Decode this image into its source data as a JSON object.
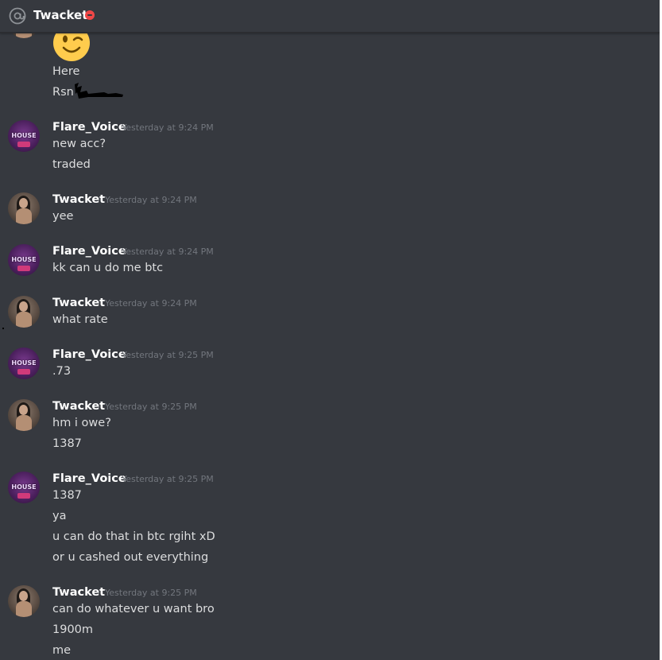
{
  "header": {
    "title": "Twacket",
    "at_icon": "at-sign-icon",
    "status_icon": "do-not-disturb-icon",
    "status_color": "#f04747"
  },
  "colors": {
    "background": "#36393f",
    "username": "#ffffff",
    "message_text": "#dcddde",
    "timestamp": "#72767d"
  },
  "first_group": {
    "emoji": "winking-face-emoji",
    "lines": [
      "Here",
      "Rsn"
    ]
  },
  "messages": [
    {
      "author": "Flare_Voice",
      "avatar": "flare-avatar",
      "avatar_text": "HOUSE",
      "timestamp": "Yesterday at 9:24 PM",
      "lines": [
        "new acc?",
        "traded"
      ]
    },
    {
      "author": "Twacket",
      "avatar": "twacket-avatar",
      "timestamp": "Yesterday at 9:24 PM",
      "lines": [
        "yee"
      ]
    },
    {
      "author": "Flare_Voice",
      "avatar": "flare-avatar",
      "avatar_text": "HOUSE",
      "timestamp": "Yesterday at 9:24 PM",
      "lines": [
        "kk can u do me btc"
      ]
    },
    {
      "author": "Twacket",
      "avatar": "twacket-avatar",
      "timestamp": "Yesterday at 9:24 PM",
      "lines": [
        "what rate"
      ]
    },
    {
      "author": "Flare_Voice",
      "avatar": "flare-avatar",
      "avatar_text": "HOUSE",
      "timestamp": "Yesterday at 9:25 PM",
      "lines": [
        ".73"
      ]
    },
    {
      "author": "Twacket",
      "avatar": "twacket-avatar",
      "timestamp": "Yesterday at 9:25 PM",
      "lines": [
        "hm i owe?",
        "1387"
      ]
    },
    {
      "author": "Flare_Voice",
      "avatar": "flare-avatar",
      "avatar_text": "HOUSE",
      "timestamp": "Yesterday at 9:25 PM",
      "lines": [
        "1387",
        "ya",
        "u can do that in btc rgiht xD",
        "or u cashed out everything"
      ]
    },
    {
      "author": "Twacket",
      "avatar": "twacket-avatar",
      "timestamp": "Yesterday at 9:25 PM",
      "lines": [
        "can do whatever u want bro",
        "1900m",
        "me"
      ]
    }
  ]
}
